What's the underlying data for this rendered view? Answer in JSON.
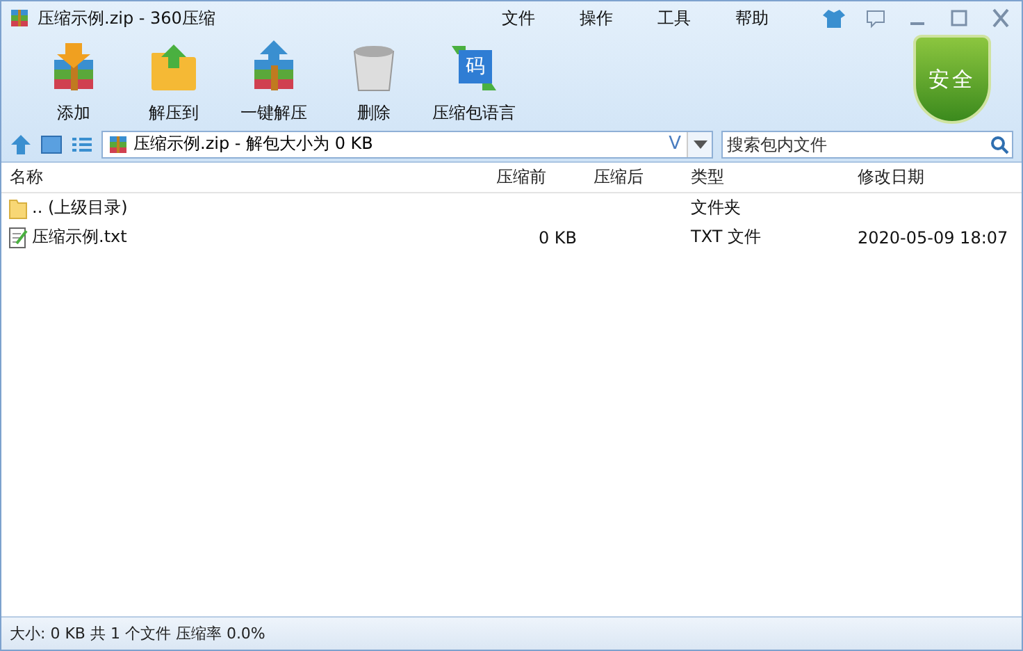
{
  "window": {
    "title": "压缩示例.zip - 360压缩"
  },
  "menu": [
    "文件",
    "操作",
    "工具",
    "帮助"
  ],
  "toolbar": [
    {
      "kind": "add",
      "label": "添加"
    },
    {
      "kind": "extract",
      "label": "解压到"
    },
    {
      "kind": "oneclick",
      "label": "一键解压"
    },
    {
      "kind": "delete",
      "label": "删除"
    },
    {
      "kind": "language",
      "label": "压缩包语言",
      "glyph": "码"
    }
  ],
  "badge": "安全",
  "address": {
    "value": "压缩示例.zip - 解包大小为 0 KB",
    "v": "V"
  },
  "search": {
    "placeholder": "搜索包内文件"
  },
  "table": {
    "columns": [
      "名称",
      "压缩前",
      "压缩后",
      "类型",
      "修改日期"
    ],
    "rows": [
      {
        "kind": "folder",
        "cells": [
          ".. (上级目录)",
          "",
          "",
          "文件夹",
          ""
        ]
      },
      {
        "kind": "file",
        "cells": [
          "压缩示例.txt",
          "0 KB",
          "",
          "TXT 文件",
          "2020-05-09 18:07"
        ]
      }
    ]
  },
  "status_bar": "大小: 0 KB 共 1 个文件 压缩率 0.0%"
}
